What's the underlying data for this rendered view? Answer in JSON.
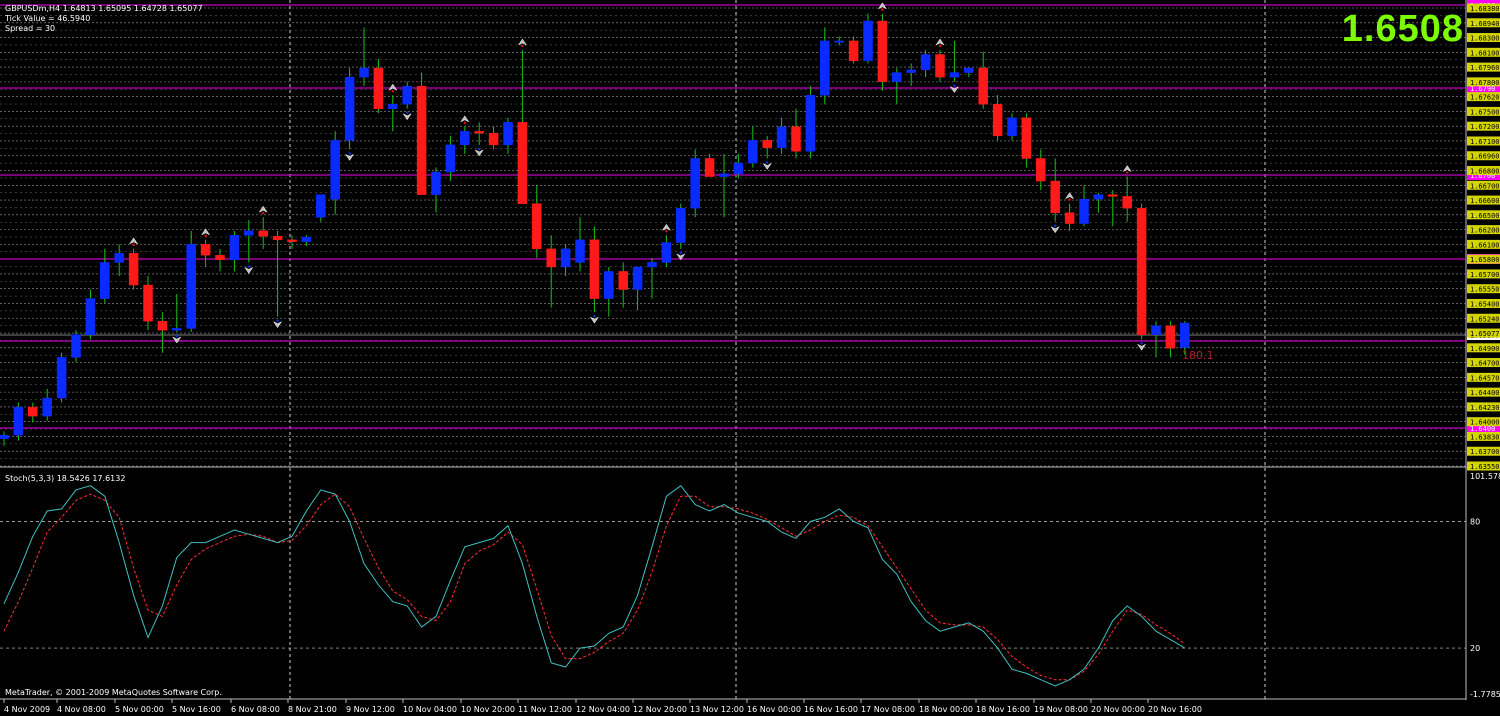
{
  "header": {
    "symbol_line": "GBPUSDm,H4  1.64813 1.65095 1.64728 1.65077",
    "tick_value": "Tick Value = 46.5940",
    "spread": "Spread = 30"
  },
  "big_price": "1.6508",
  "copyright": "MetaQuotes Software Corp.",
  "copyright_full": "MetaTrader, © 2001-2009 MetaQuotes Software Corp.",
  "pip_label": "180.1",
  "colors": {
    "bull": "#0a2bff",
    "bear": "#ff1a1a",
    "wick": "#19c219",
    "hline": "#c000c0",
    "price_axis_bg": "#d4d400",
    "stoch_main": "#40c0c0",
    "stoch_signal": "#ff3030",
    "big_price": "#7CFC00"
  },
  "chart_data": [
    {
      "type": "candlestick",
      "title": "GBPUSDm,H4",
      "price_axis_labels": [
        "1.68380",
        "1.68940",
        "1.68300",
        "1.68100",
        "1.67960",
        "1.67800",
        "1.67620",
        "1.67500",
        "1.67200",
        "1.67100",
        "1.66960",
        "1.66800",
        "1.66700",
        "1.66600",
        "1.66500",
        "1.66200",
        "1.66100",
        "1.65800",
        "1.65700",
        "1.65550",
        "1.65400",
        "1.65240",
        "1.65077",
        "1.64900",
        "1.64700",
        "1.64570",
        "1.64400",
        "1.64230",
        "1.64000",
        "1.63830",
        "1.63700",
        "1.63550"
      ],
      "ylim": [
        1.6355,
        1.6842
      ],
      "horizontal_levels": [
        {
          "value": 1.6838,
          "label": "1.6838"
        },
        {
          "value": 1.679,
          "label": "1.6790"
        },
        {
          "value": 1.67,
          "label": "1.6700"
        },
        {
          "value": 1.66,
          "label": "1.6600"
        },
        {
          "value": 1.6502,
          "label": ""
        },
        {
          "value": 1.64,
          "label": "1.6400"
        }
      ],
      "current_price": 1.65077,
      "x_labels": [
        "4 Nov 2009",
        "4 Nov 08:00",
        "5 Nov 00:00",
        "5 Nov 16:00",
        "6 Nov 08:00",
        "8 Nov 21:00",
        "9 Nov 12:00",
        "10 Nov 04:00",
        "10 Nov 20:00",
        "11 Nov 12:00",
        "12 Nov 04:00",
        "12 Nov 20:00",
        "13 Nov 12:00",
        "16 Nov 00:00",
        "16 Nov 16:00",
        "17 Nov 08:00",
        "18 Nov 00:00",
        "18 Nov 16:00",
        "19 Nov 08:00",
        "20 Nov 00:00",
        "20 Nov 16:00"
      ],
      "candles": [
        [
          1.638,
          1.6388,
          1.6372,
          1.6384
        ],
        [
          1.6384,
          1.642,
          1.6378,
          1.6415
        ],
        [
          1.6415,
          1.642,
          1.6398,
          1.6405
        ],
        [
          1.6405,
          1.6435,
          1.64,
          1.6425
        ],
        [
          1.6425,
          1.6475,
          1.642,
          1.647
        ],
        [
          1.647,
          1.65,
          1.6465,
          1.6495
        ],
        [
          1.6495,
          1.6545,
          1.649,
          1.6535
        ],
        [
          1.6535,
          1.659,
          1.653,
          1.6575
        ],
        [
          1.6575,
          1.6595,
          1.656,
          1.6585
        ],
        [
          1.6585,
          1.659,
          1.6545,
          1.655
        ],
        [
          1.655,
          1.656,
          1.65,
          1.651
        ],
        [
          1.651,
          1.652,
          1.6475,
          1.65
        ],
        [
          1.65,
          1.654,
          1.6498,
          1.6502
        ],
        [
          1.6502,
          1.661,
          1.6498,
          1.6595
        ],
        [
          1.6595,
          1.66,
          1.657,
          1.6583
        ],
        [
          1.6583,
          1.659,
          1.6565,
          1.6578
        ],
        [
          1.6578,
          1.661,
          1.6565,
          1.6605
        ],
        [
          1.6605,
          1.6622,
          1.6575,
          1.661
        ],
        [
          1.661,
          1.6625,
          1.659,
          1.6604
        ],
        [
          1.6604,
          1.661,
          1.6515,
          1.66
        ],
        [
          1.66,
          1.6605,
          1.659,
          1.6598
        ],
        [
          1.6598,
          1.6605,
          1.6593,
          1.6603
        ],
        [
          1.6625,
          1.664,
          1.662,
          1.665
        ],
        [
          1.6645,
          1.672,
          1.6628,
          1.671
        ],
        [
          1.671,
          1.679,
          1.67,
          1.678
        ],
        [
          1.678,
          1.6835,
          1.677,
          1.679
        ],
        [
          1.679,
          1.68,
          1.674,
          1.6745
        ],
        [
          1.6745,
          1.676,
          1.672,
          1.675
        ],
        [
          1.675,
          1.6775,
          1.6745,
          1.677
        ],
        [
          1.677,
          1.6785,
          1.6655,
          1.665
        ],
        [
          1.665,
          1.668,
          1.663,
          1.6675
        ],
        [
          1.6675,
          1.6715,
          1.6665,
          1.6705
        ],
        [
          1.6705,
          1.6725,
          1.6695,
          1.672
        ],
        [
          1.672,
          1.673,
          1.6705,
          1.6718
        ],
        [
          1.6718,
          1.6725,
          1.67,
          1.6705
        ],
        [
          1.6705,
          1.6735,
          1.6695,
          1.673
        ],
        [
          1.673,
          1.681,
          1.67,
          1.664
        ],
        [
          1.664,
          1.666,
          1.658,
          1.659
        ],
        [
          1.659,
          1.6605,
          1.6525,
          1.657
        ],
        [
          1.657,
          1.6595,
          1.656,
          1.659
        ],
        [
          1.6575,
          1.6625,
          1.6565,
          1.66
        ],
        [
          1.66,
          1.6615,
          1.652,
          1.6535
        ],
        [
          1.6535,
          1.657,
          1.6515,
          1.6565
        ],
        [
          1.6565,
          1.6575,
          1.6525,
          1.6545
        ],
        [
          1.6545,
          1.657,
          1.6522,
          1.657
        ],
        [
          1.657,
          1.658,
          1.6535,
          1.6575
        ],
        [
          1.6575,
          1.6605,
          1.657,
          1.6597
        ],
        [
          1.6597,
          1.664,
          1.659,
          1.6635
        ],
        [
          1.6635,
          1.67,
          1.6625,
          1.669
        ],
        [
          1.669,
          1.6695,
          1.667,
          1.667
        ],
        [
          1.667,
          1.6695,
          1.6625,
          1.6673
        ],
        [
          1.6673,
          1.6695,
          1.6668,
          1.6685
        ],
        [
          1.6685,
          1.6725,
          1.668,
          1.671
        ],
        [
          1.671,
          1.6715,
          1.669,
          1.6702
        ],
        [
          1.6702,
          1.6735,
          1.6695,
          1.6725
        ],
        [
          1.6725,
          1.6745,
          1.669,
          1.6698
        ],
        [
          1.6698,
          1.677,
          1.669,
          1.676
        ],
        [
          1.676,
          1.6835,
          1.675,
          1.682
        ],
        [
          1.682,
          1.6825,
          1.6815,
          1.682
        ],
        [
          1.682,
          1.6825,
          1.6795,
          1.6798
        ],
        [
          1.6798,
          1.685,
          1.6795,
          1.6842
        ],
        [
          1.6842,
          1.685,
          1.6765,
          1.6775
        ],
        [
          1.6775,
          1.679,
          1.675,
          1.6785
        ],
        [
          1.6785,
          1.6795,
          1.677,
          1.6788
        ],
        [
          1.6788,
          1.681,
          1.678,
          1.6805
        ],
        [
          1.6805,
          1.681,
          1.6775,
          1.678
        ],
        [
          1.678,
          1.682,
          1.6775,
          1.6785
        ],
        [
          1.6785,
          1.679,
          1.678,
          1.679
        ],
        [
          1.679,
          1.6808,
          1.6745,
          1.675
        ],
        [
          1.675,
          1.676,
          1.671,
          1.6715
        ],
        [
          1.6715,
          1.674,
          1.671,
          1.6735
        ],
        [
          1.6735,
          1.674,
          1.668,
          1.669
        ],
        [
          1.669,
          1.67,
          1.6655,
          1.6665
        ],
        [
          1.6665,
          1.669,
          1.662,
          1.663
        ],
        [
          1.663,
          1.664,
          1.661,
          1.6618
        ],
        [
          1.6618,
          1.666,
          1.6615,
          1.6645
        ],
        [
          1.6645,
          1.6652,
          1.663,
          1.665
        ],
        [
          1.665,
          1.6655,
          1.6615,
          1.6648
        ],
        [
          1.6648,
          1.667,
          1.662,
          1.6635
        ],
        [
          1.6635,
          1.664,
          1.649,
          1.6495
        ],
        [
          1.6495,
          1.651,
          1.647,
          1.6505
        ],
        [
          1.6505,
          1.651,
          1.647,
          1.648
        ],
        [
          1.6481,
          1.651,
          1.6473,
          1.6508
        ]
      ],
      "fractals_up": [
        9,
        14,
        18,
        27,
        32,
        36,
        46,
        61,
        65,
        74,
        78
      ],
      "fractals_down": [
        12,
        17,
        19,
        24,
        28,
        33,
        41,
        47,
        53,
        66,
        73,
        79
      ]
    },
    {
      "type": "line",
      "title": "Stoch(5,3,3) 18.5426 17.6132",
      "ylim": [
        -1.7785,
        101.5785
      ],
      "y_ticks": [
        {
          "value": 101.5785,
          "label": "101.5785"
        },
        {
          "value": 80,
          "label": "80"
        },
        {
          "value": 20,
          "label": "20"
        },
        {
          "value": -1.7785,
          "label": "-1.7785"
        }
      ],
      "series": [
        {
          "name": "Main",
          "values": [
            41,
            56,
            73,
            85,
            86,
            95,
            97,
            92,
            70,
            45,
            25,
            40,
            63,
            70,
            70,
            73,
            76,
            74,
            72,
            70,
            73,
            85,
            95,
            93,
            80,
            60,
            50,
            42,
            40,
            30,
            35,
            52,
            68,
            70,
            72,
            78,
            60,
            35,
            13,
            11,
            20,
            21,
            27,
            30,
            45,
            68,
            92,
            97,
            88,
            85,
            88,
            84,
            82,
            80,
            75,
            72,
            80,
            82,
            86,
            80,
            77,
            62,
            55,
            42,
            33,
            28,
            30,
            32,
            28,
            20,
            10,
            8,
            5,
            2,
            5,
            10,
            20,
            33,
            40,
            35,
            28,
            24,
            20
          ]
        },
        {
          "name": "Signal",
          "values": [
            28,
            42,
            58,
            75,
            82,
            90,
            93,
            90,
            82,
            58,
            38,
            35,
            50,
            62,
            67,
            70,
            73,
            74,
            73,
            70,
            71,
            78,
            88,
            93,
            87,
            72,
            58,
            47,
            43,
            35,
            33,
            42,
            60,
            66,
            69,
            75,
            69,
            48,
            26,
            15,
            15,
            18,
            23,
            27,
            38,
            56,
            78,
            92,
            92,
            87,
            87,
            86,
            84,
            81,
            77,
            73,
            76,
            80,
            83,
            82,
            78,
            68,
            58,
            48,
            38,
            32,
            31,
            31,
            30,
            24,
            16,
            11,
            7,
            5,
            5,
            9,
            17,
            28,
            38,
            36,
            31,
            27,
            22
          ]
        }
      ]
    }
  ]
}
